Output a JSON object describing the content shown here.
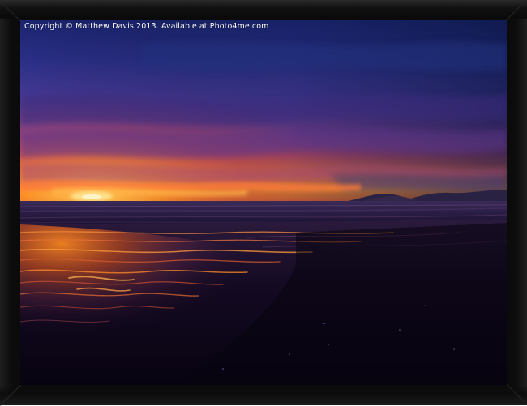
{
  "watermark": {
    "text": "Copyright © Matthew Davis 2013. Available at Photo4me.com"
  },
  "photo": {
    "subject": "sunset over wet sand beach with mountains on the horizon",
    "colors": {
      "sky_top": "#1e2a78",
      "sky_mid": "#5a2f8a",
      "glow": "#ff8a1e",
      "sand_reflection": "#d9541c",
      "sand_dark": "#0c0616"
    }
  },
  "frame": {
    "color": "#0b0b0b"
  }
}
